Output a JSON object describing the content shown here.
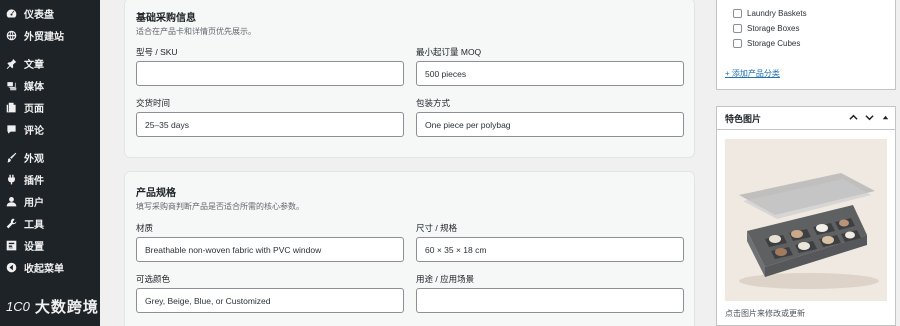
{
  "sidebar": {
    "items": [
      {
        "label": "仪表盘",
        "icon": "dashboard-icon"
      },
      {
        "label": "外贸建站",
        "icon": "globe-icon"
      },
      {
        "label": "文章",
        "icon": "pin-icon"
      },
      {
        "label": "媒体",
        "icon": "media-icon"
      },
      {
        "label": "页面",
        "icon": "page-icon"
      },
      {
        "label": "评论",
        "icon": "comment-icon"
      },
      {
        "label": "外观",
        "icon": "paintbrush-icon"
      },
      {
        "label": "插件",
        "icon": "plugin-icon"
      },
      {
        "label": "用户",
        "icon": "user-icon"
      },
      {
        "label": "工具",
        "icon": "wrench-icon"
      },
      {
        "label": "设置",
        "icon": "settings-icon"
      },
      {
        "label": "收起菜单",
        "icon": "collapse-icon"
      }
    ],
    "watermark": {
      "logo": "1C0",
      "text": "大数跨境"
    }
  },
  "basic": {
    "title": "基础采购信息",
    "desc": "适合在产品卡和详情页优先展示。",
    "sku": {
      "label": "型号 / SKU",
      "value": ""
    },
    "moq": {
      "label": "最小起订量 MOQ",
      "value": "500 pieces"
    },
    "lead": {
      "label": "交货时间",
      "value": "25–35 days"
    },
    "pack": {
      "label": "包装方式",
      "value": "One piece per polybag"
    }
  },
  "spec": {
    "title": "产品规格",
    "desc": "填写采购商判断产品是否适合所需的核心参数。",
    "material": {
      "label": "材质",
      "value": "Breathable non-woven fabric with PVC window"
    },
    "size": {
      "label": "尺寸 / 规格",
      "value": "60 × 35 × 18 cm"
    },
    "colors": {
      "label": "可选颜色",
      "value": "Grey, Beige, Blue, or Customized"
    },
    "usage": {
      "label": "用途 / 应用场景",
      "value": ""
    }
  },
  "categories": {
    "items": [
      "Laundry Baskets",
      "Storage Boxes",
      "Storage Cubes"
    ],
    "add_link": "+ 添加产品分类"
  },
  "featured": {
    "title": "特色图片",
    "hint": "点击图片来修改或更新"
  },
  "colors": {
    "sidebar_bg": "#1d2327",
    "link": "#2271b1",
    "product_grey": "#6d6e70"
  }
}
